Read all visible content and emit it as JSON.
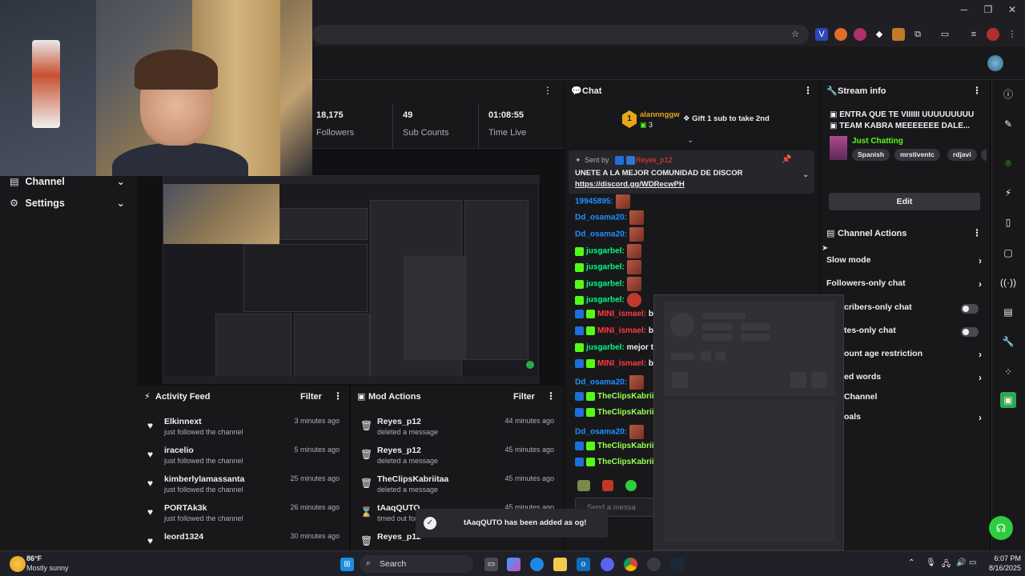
{
  "stats": {
    "followers_value": "18,175",
    "followers_label": "Followers",
    "subs_value": "49",
    "subs_label": "Sub Counts",
    "time_value": "01:08:55",
    "time_label": "Time Live"
  },
  "left_nav": {
    "items": [
      {
        "label": "Channel"
      },
      {
        "label": "Settings"
      }
    ]
  },
  "activity_feed": {
    "title": "Activity Feed",
    "filter": "Filter",
    "rows": [
      {
        "name": "Elkinnext",
        "action": "just followed the channel",
        "time": "3 minutes ago"
      },
      {
        "name": "iracelio",
        "action": "just followed the channel",
        "time": "5 minutes ago"
      },
      {
        "name": "kimberlylamassanta",
        "action": "just followed the channel",
        "time": "25 minutes ago"
      },
      {
        "name": "PORTAk3k",
        "action": "just followed the channel",
        "time": "26 minutes ago"
      },
      {
        "name": "leord1324",
        "action": "",
        "time": "30 minutes ago"
      }
    ]
  },
  "mod_actions": {
    "title": "Mod Actions",
    "filter": "Filter",
    "rows": [
      {
        "name": "Reyes_p12",
        "action": "deleted a message",
        "time": "44 minutes ago"
      },
      {
        "name": "Reyes_p12",
        "action": "deleted a message",
        "time": "45 minutes ago"
      },
      {
        "name": "TheClipsKabriitaa",
        "action": "deleted a message",
        "time": "45 minutes ago"
      },
      {
        "name": "tAaqQUTO",
        "action": "timed out for",
        "time": "45 minutes ago"
      },
      {
        "name": "Reyes_p12",
        "action": "deleted a message",
        "time": ""
      }
    ]
  },
  "chat": {
    "title": "Chat",
    "gift_user": "alannnggw",
    "gift_rank": "1",
    "gift_count": "3",
    "gift_cta": "Gift 1 sub to take 2nd",
    "pinned_by_label": "Sent by",
    "pinned_by_user": "Reyes_p12",
    "pinned_text": "UNETE A LA MEJOR COMUNIDAD DE DISCOR",
    "pinned_link": "https://discord.gg/WDRecwPH",
    "input_placeholder": "Send a messa",
    "messages": [
      {
        "user": "19945895:",
        "color": "#1e90ff",
        "text": ""
      },
      {
        "user": "Dd_osama20:",
        "color": "#1e90ff",
        "text": ""
      },
      {
        "user": "Dd_osama20:",
        "color": "#1e90ff",
        "text": ""
      },
      {
        "user": "jusgarbel:",
        "color": "#00ff7f",
        "text": ""
      },
      {
        "user": "jusgarbel:",
        "color": "#00ff7f",
        "text": ""
      },
      {
        "user": "jusgarbel:",
        "color": "#00ff7f",
        "text": ""
      },
      {
        "user": "jusgarbel:",
        "color": "#00ff7f",
        "text": ""
      },
      {
        "user": "MINI_ismael:",
        "color": "#ff3b3b",
        "text": "bu"
      },
      {
        "user": "MINI_ismael:",
        "color": "#ff3b3b",
        "text": "bu"
      },
      {
        "user": "jusgarbel:",
        "color": "#00ff7f",
        "text": "mejor te h"
      },
      {
        "user": "MINI_ismael:",
        "color": "#ff3b3b",
        "text": "bu"
      },
      {
        "user": "Dd_osama20:",
        "color": "#1e90ff",
        "text": ""
      },
      {
        "user": "TheClipsKabriita",
        "color": "#9aff4f",
        "text": ""
      },
      {
        "user": "TheClipsKabriita",
        "color": "#9aff4f",
        "text": ""
      },
      {
        "user": "Dd_osama20:",
        "color": "#1e90ff",
        "text": ""
      },
      {
        "user": "TheClipsKabriita",
        "color": "#9aff4f",
        "text": ""
      },
      {
        "user": "TheClipsKabriita",
        "color": "#9aff4f",
        "text": ""
      }
    ]
  },
  "stream_info": {
    "title": "Stream info",
    "line1": "ENTRA QUE TE VIIIIII UUUUUUUUU",
    "line2": "TEAM KABRA MEEEEEEE DALE...",
    "category": "Just Chatting",
    "tags": [
      "Spanish",
      "mrstiventc",
      "rdjavi",
      "spa"
    ],
    "edit": "Edit"
  },
  "channel_actions": {
    "title": "Channel Actions",
    "items": [
      {
        "label": "Slow mode"
      },
      {
        "label": "Followers-only chat"
      },
      {
        "label": "cribers-only chat"
      },
      {
        "label": "tes-only chat"
      },
      {
        "label": "ount age restriction"
      },
      {
        "label": "ed words"
      },
      {
        "label": "Channel"
      },
      {
        "label": "oals"
      }
    ]
  },
  "toast": {
    "text": "tAaqQUTO has been added as og!"
  },
  "taskbar": {
    "weather_temp": "86°F",
    "weather_desc": "Mostly sunny",
    "search": "Search",
    "time": "6:07 PM",
    "date": "8/16/2025"
  },
  "colors": {
    "accent": "#00e701",
    "twitch": "#9147ff",
    "kick_green": "#53fc18"
  }
}
